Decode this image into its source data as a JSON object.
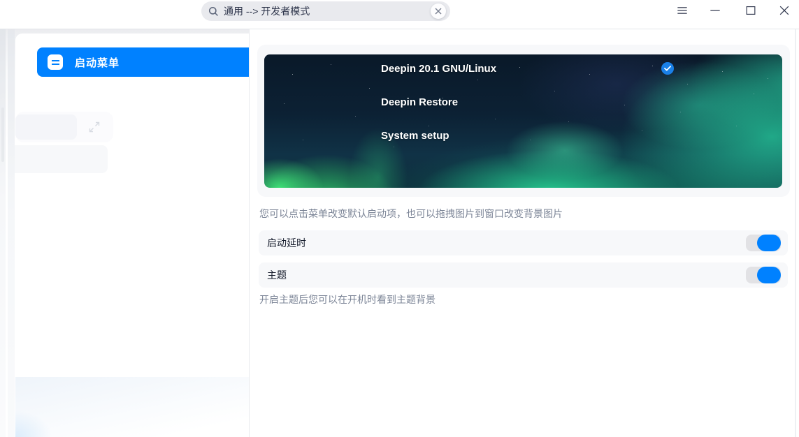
{
  "titlebar": {
    "search": {
      "value": "通用 --> 开发者模式",
      "clear_icon": "close-circle-icon"
    },
    "controls": {
      "menu_icon": "hamburger-menu-icon",
      "minimize_icon": "minimize-icon",
      "maximize_icon": "maximize-icon",
      "close_icon": "close-icon"
    }
  },
  "sidebar": {
    "items": [
      {
        "label": "启动菜单",
        "icon": "boot-menu-icon",
        "selected": true
      }
    ]
  },
  "preview": {
    "entries": [
      {
        "label": "Deepin 20.1 GNU/Linux",
        "default": true
      },
      {
        "label": "Deepin Restore",
        "default": false
      },
      {
        "label": "System setup",
        "default": false
      }
    ],
    "default_badge_icon": "check-icon"
  },
  "settings": {
    "hint_top": "您可以点击菜单改变默认启动项，也可以拖拽图片到窗口改变背景图片",
    "rows": [
      {
        "label": "启动延时",
        "enabled": true
      },
      {
        "label": "主题",
        "enabled": true
      }
    ],
    "hint_bottom": "开启主题后您可以在开机时看到主题背景"
  },
  "colors": {
    "accent": "#0081ff",
    "check_badge": "#1a80e8",
    "row_background": "#f7f8fa",
    "hint_text": "#7b8496"
  }
}
